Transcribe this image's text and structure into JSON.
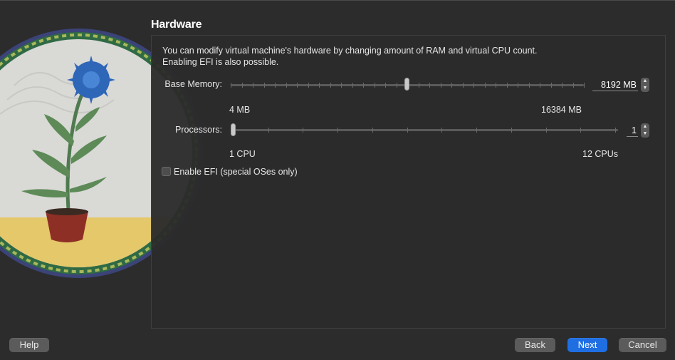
{
  "page": {
    "title": "Hardware",
    "description_line1": "You can modify virtual machine's hardware by changing amount of RAM and virtual CPU count.",
    "description_line2": "Enabling EFI is also possible."
  },
  "memory": {
    "label": "Base Memory:",
    "value": "8192 MB",
    "min_label": "4 MB",
    "max_label": "16384 MB",
    "slider_fraction": 0.5
  },
  "processors": {
    "label": "Processors:",
    "value": "1",
    "min_label": "1 CPU",
    "max_label": "12 CPUs",
    "slider_fraction": 0.0
  },
  "efi": {
    "label": "Enable EFI (special OSes only)",
    "checked": false
  },
  "buttons": {
    "help": "Help",
    "back": "Back",
    "next": "Next",
    "cancel": "Cancel"
  },
  "icons": {
    "stepper_up": "chevron-up-icon",
    "stepper_down": "chevron-down-icon",
    "illustration": "potted-flower-illustration"
  },
  "colors": {
    "background": "#2c2c2c",
    "accent": "#1f6fe3"
  }
}
